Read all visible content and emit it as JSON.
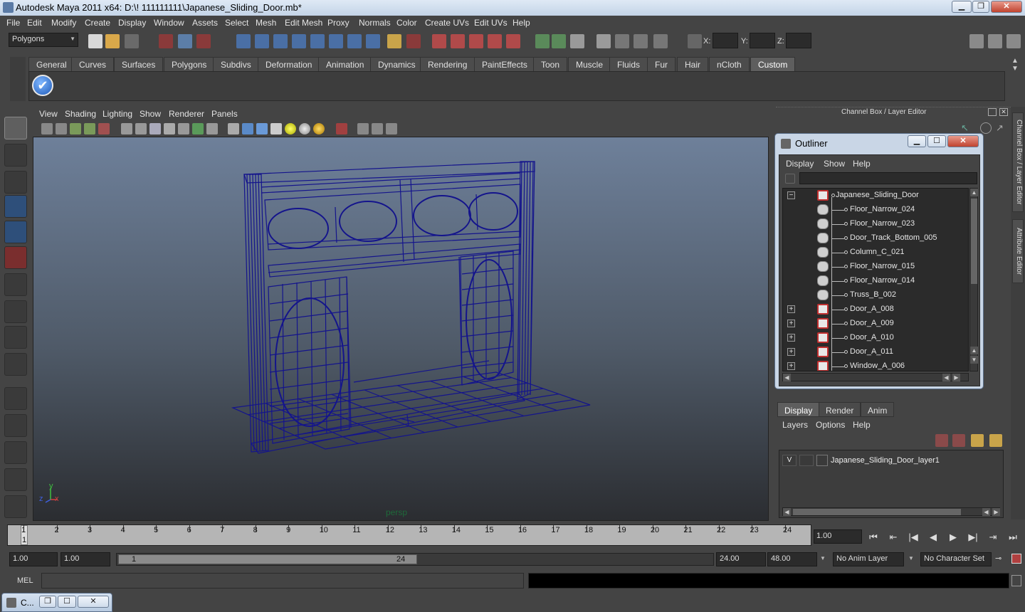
{
  "window": {
    "title": "Autodesk Maya 2011 x64: D:\\! 111111111\\Japanese_Sliding_Door.mb*",
    "minimize": "▁",
    "maximize": "❐",
    "close": "✕"
  },
  "menubar": [
    "File",
    "Edit",
    "Modify",
    "Create",
    "Display",
    "Window",
    "Assets",
    "Select",
    "Mesh",
    "Edit Mesh",
    "Proxy",
    "Normals",
    "Color",
    "Create UVs",
    "Edit UVs",
    "Help"
  ],
  "statusline": {
    "menuset": "Polygons",
    "x_label": "X:",
    "y_label": "Y:",
    "z_label": "Z:"
  },
  "shelf": {
    "tabs": [
      "General",
      "Curves",
      "Surfaces",
      "Polygons",
      "Subdivs",
      "Deformation",
      "Animation",
      "Dynamics",
      "Rendering",
      "PaintEffects",
      "Toon",
      "Muscle",
      "Fluids",
      "Fur",
      "Hair",
      "nCloth",
      "Custom"
    ],
    "active_tab": "Custom",
    "check_glyph": "✔"
  },
  "viewport": {
    "menu": [
      "View",
      "Shading",
      "Lighting",
      "Show",
      "Renderer",
      "Panels"
    ],
    "camera_label": "persp",
    "axis_y": "y",
    "axis_x": "x",
    "axis_z": "z"
  },
  "channel_box": {
    "title": "Channel Box / Layer Editor",
    "side_tab_channel": "Channel Box / Layer Editor",
    "side_tab_attr": "Attribute Editor"
  },
  "outliner": {
    "title": "Outliner",
    "menu": [
      "Display",
      "Show",
      "Help"
    ],
    "items": [
      {
        "name": "Japanese_Sliding_Door",
        "type": "group",
        "expander": "−"
      },
      {
        "name": "Floor_Narrow_024",
        "type": "mesh",
        "expander": ""
      },
      {
        "name": "Floor_Narrow_023",
        "type": "mesh",
        "expander": ""
      },
      {
        "name": "Door_Track_Bottom_005",
        "type": "mesh",
        "expander": ""
      },
      {
        "name": "Column_C_021",
        "type": "mesh",
        "expander": ""
      },
      {
        "name": "Floor_Narrow_015",
        "type": "mesh",
        "expander": ""
      },
      {
        "name": "Floor_Narrow_014",
        "type": "mesh",
        "expander": ""
      },
      {
        "name": "Truss_B_002",
        "type": "mesh",
        "expander": ""
      },
      {
        "name": "Door_A_008",
        "type": "group",
        "expander": "+"
      },
      {
        "name": "Door_A_009",
        "type": "group",
        "expander": "+"
      },
      {
        "name": "Door_A_010",
        "type": "group",
        "expander": "+"
      },
      {
        "name": "Door_A_011",
        "type": "group",
        "expander": "+"
      },
      {
        "name": "Window_A_006",
        "type": "group",
        "expander": "+"
      }
    ]
  },
  "layer_editor": {
    "tabs": [
      "Display",
      "Render",
      "Anim"
    ],
    "active_tab": "Display",
    "menu": [
      "Layers",
      "Options",
      "Help"
    ],
    "layers": [
      {
        "visible": "V",
        "name": "Japanese_Sliding_Door_layer1"
      }
    ]
  },
  "time_slider": {
    "ticks": [
      1,
      2,
      3,
      4,
      5,
      6,
      7,
      8,
      9,
      10,
      11,
      12,
      13,
      14,
      15,
      16,
      17,
      18,
      19,
      20,
      21,
      22,
      23,
      24
    ],
    "current_frame": "1",
    "current_time_field": "1.00",
    "playback_buttons": [
      "⏮",
      "⇤",
      "|◀",
      "◀",
      "▶",
      "▶|",
      "⇥",
      "⏭"
    ]
  },
  "range_slider": {
    "start_time": "1.00",
    "playback_start": "1.00",
    "handle_start": "1",
    "handle_end": "24",
    "playback_end": "24.00",
    "end_time": "48.00",
    "anim_layer": "No Anim Layer",
    "character_set": "No Character Set"
  },
  "command_line": {
    "label": "MEL"
  },
  "minimized_window": {
    "title": "C..."
  },
  "colors": {
    "wireframe": "#14148c",
    "viewport_top": "#6e809a",
    "viewport_bottom": "#2b2d31",
    "ui_bg": "#444444"
  }
}
